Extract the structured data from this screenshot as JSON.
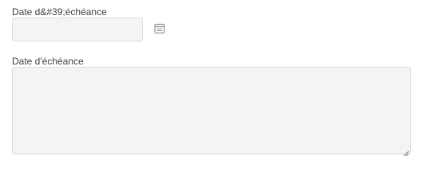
{
  "fields": {
    "date": {
      "label": "Date d&#39;échéance",
      "value": "",
      "placeholder": "",
      "icon": "calendar-icon"
    },
    "notes": {
      "label": "Date d'échéance",
      "value": "",
      "placeholder": ""
    }
  },
  "colors": {
    "input_background": "#f3f4f6",
    "input_border": "#d9dce1",
    "icon": "#8a96a3",
    "label_text": "#3a3f45"
  }
}
